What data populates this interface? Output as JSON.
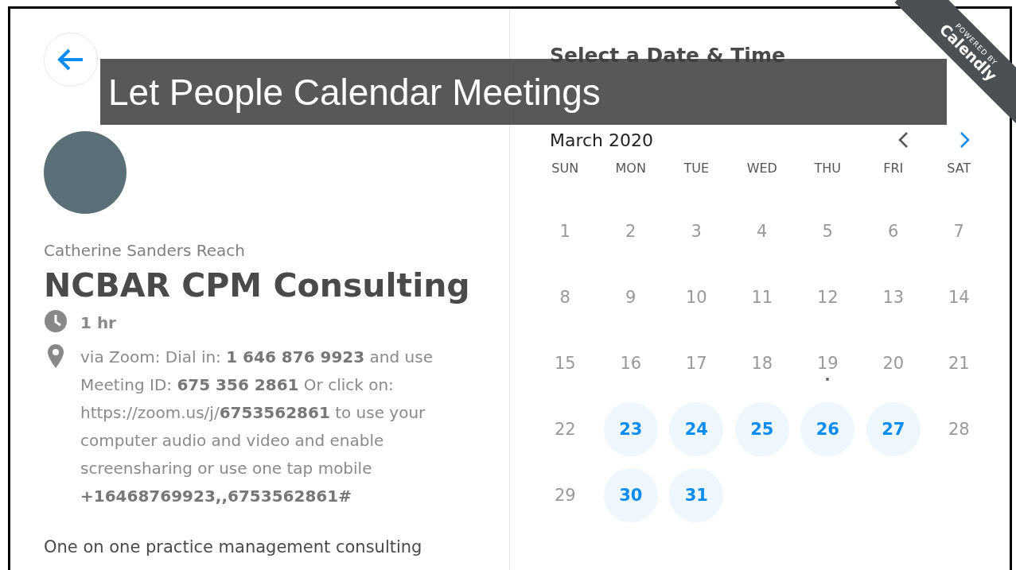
{
  "slide_title": "Let People Calendar Meetings",
  "ribbon": {
    "top": "POWERED BY",
    "brand": "Calendly"
  },
  "event": {
    "host": "Catherine Sanders Reach",
    "title": "NCBAR CPM Consulting",
    "duration": "1 hr",
    "location": "via Zoom: Dial in: **1 646 876 9923** and use Meeting ID: **675 356 2861** Or click on: https://zoom.us/j/**6753562861** to use your computer audio and video and enable screensharing or use one tap mobile **+16468769923,,6753562861#**",
    "description": "One on one practice management consulting"
  },
  "calendar": {
    "heading": "Select a Date & Time",
    "month": "March 2020",
    "prev_enabled": false,
    "next_enabled": true,
    "weekdays": [
      "SUN",
      "MON",
      "TUE",
      "WED",
      "THU",
      "FRI",
      "SAT"
    ],
    "weeks": [
      [
        {
          "day": "1",
          "available": false,
          "today": false
        },
        {
          "day": "2",
          "available": false,
          "today": false
        },
        {
          "day": "3",
          "available": false,
          "today": false
        },
        {
          "day": "4",
          "available": false,
          "today": false
        },
        {
          "day": "5",
          "available": false,
          "today": false
        },
        {
          "day": "6",
          "available": false,
          "today": false
        },
        {
          "day": "7",
          "available": false,
          "today": false
        }
      ],
      [
        {
          "day": "8",
          "available": false,
          "today": false
        },
        {
          "day": "9",
          "available": false,
          "today": false
        },
        {
          "day": "10",
          "available": false,
          "today": false
        },
        {
          "day": "11",
          "available": false,
          "today": false
        },
        {
          "day": "12",
          "available": false,
          "today": false
        },
        {
          "day": "13",
          "available": false,
          "today": false
        },
        {
          "day": "14",
          "available": false,
          "today": false
        }
      ],
      [
        {
          "day": "15",
          "available": false,
          "today": false
        },
        {
          "day": "16",
          "available": false,
          "today": false
        },
        {
          "day": "17",
          "available": false,
          "today": false
        },
        {
          "day": "18",
          "available": false,
          "today": false
        },
        {
          "day": "19",
          "available": false,
          "today": true
        },
        {
          "day": "20",
          "available": false,
          "today": false
        },
        {
          "day": "21",
          "available": false,
          "today": false
        }
      ],
      [
        {
          "day": "22",
          "available": false,
          "today": false
        },
        {
          "day": "23",
          "available": true,
          "today": false
        },
        {
          "day": "24",
          "available": true,
          "today": false
        },
        {
          "day": "25",
          "available": true,
          "today": false
        },
        {
          "day": "26",
          "available": true,
          "today": false
        },
        {
          "day": "27",
          "available": true,
          "today": false
        },
        {
          "day": "28",
          "available": false,
          "today": false
        }
      ],
      [
        {
          "day": "29",
          "available": false,
          "today": false
        },
        {
          "day": "30",
          "available": true,
          "today": false
        },
        {
          "day": "31",
          "available": true,
          "today": false
        }
      ]
    ]
  }
}
